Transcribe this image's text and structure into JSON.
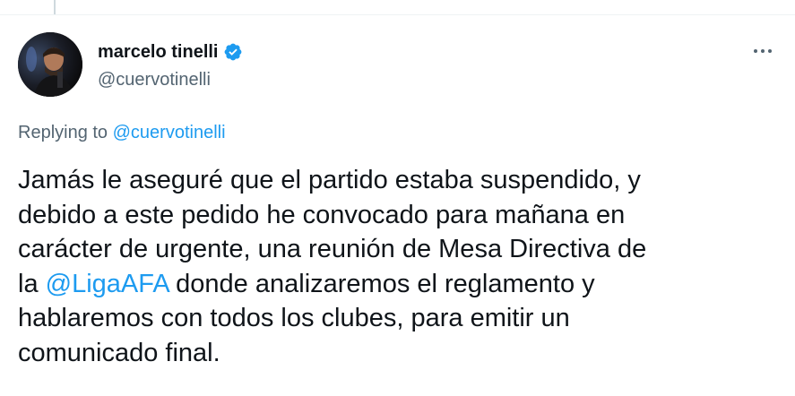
{
  "colors": {
    "accent": "#1d9bf0",
    "secondary_text": "#536471",
    "primary_text": "#0f1419"
  },
  "author": {
    "display_name": "marcelo tinelli",
    "handle": "@cuervotinelli",
    "verified_icon": "verified-badge-icon",
    "avatar_icon": "avatar"
  },
  "more_icon": "more-dots-icon",
  "reply": {
    "prefix": "Replying to ",
    "mention": "@cuervotinelli"
  },
  "tweet": {
    "text_before": "Jamás le aseguré que el partido estaba suspendido, y\ndebido a este pedido he convocado para mañana en\ncarácter de urgente, una reunión de Mesa Directiva de\nla ",
    "mention": "@LigaAFA",
    "text_after": " donde analizaremos el reglamento y\nhablaremos con todos los clubes, para emitir un\ncomunicado final."
  }
}
